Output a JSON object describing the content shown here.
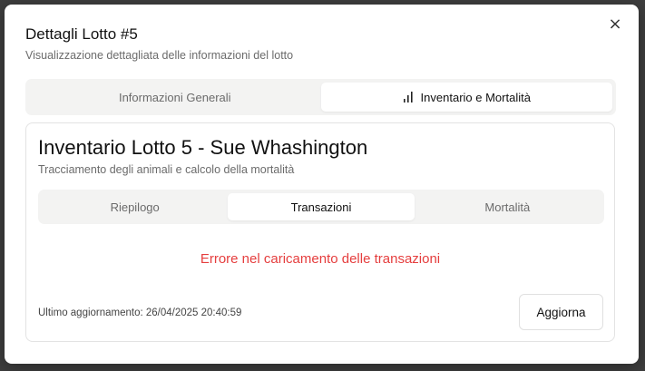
{
  "dialog": {
    "title": "Dettagli Lotto #5",
    "subtitle": "Visualizzazione dettagliata delle informazioni del lotto",
    "close_symbol": "×"
  },
  "main_tabs": [
    {
      "label": "Informazioni Generali",
      "active": false
    },
    {
      "label": "Inventario e Mortalità",
      "active": true,
      "icon": "bar-chart-icon"
    }
  ],
  "inventory": {
    "title": "Inventario Lotto 5 - Sue Whashington",
    "subtitle": "Tracciamento degli animali e calcolo della mortalità",
    "tabs": [
      {
        "label": "Riepilogo",
        "active": false
      },
      {
        "label": "Transazioni",
        "active": true
      },
      {
        "label": "Mortalità",
        "active": false
      }
    ],
    "error_message": "Errore nel caricamento delle transazioni",
    "last_update": "Ultimo aggiornamento: 26/04/2025 20:40:59",
    "refresh_label": "Aggiorna"
  },
  "colors": {
    "error": "#e53e3e",
    "tab_track": "#f3f3f2"
  }
}
